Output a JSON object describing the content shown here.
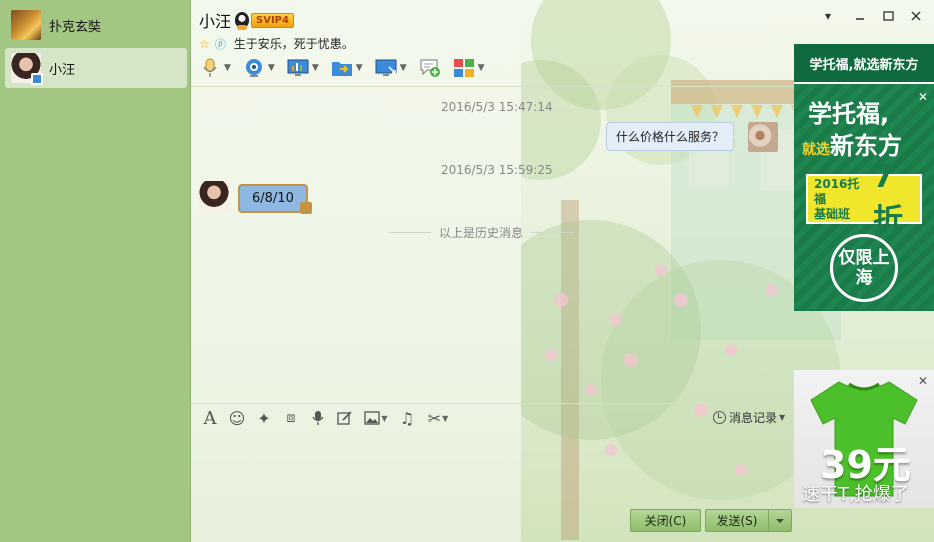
{
  "sidebar": {
    "contacts": [
      {
        "name": "扑克玄奘",
        "avatar": "group-avatar-icon"
      },
      {
        "name": "小汪",
        "avatar": "user-avatar-icon",
        "selected": true
      }
    ]
  },
  "header": {
    "title": "小汪",
    "vip_badge": "SVIP4",
    "signature": "生于安乐，死于忧患。"
  },
  "toolbar": {
    "items": [
      "microphone-icon",
      "video-camera-icon",
      "screen-share-icon",
      "file-transfer-icon",
      "remote-desktop-icon",
      "add-chat-icon",
      "apps-icon"
    ]
  },
  "chat": {
    "messages": [
      {
        "timestamp": "2016/5/3 15:47:14",
        "direction": "outgoing",
        "text": "什么价格什么服务？"
      },
      {
        "timestamp": "2016/5/3 15:59:25",
        "direction": "incoming",
        "text": "6/8/10"
      }
    ],
    "history_divider": "以上是历史消息"
  },
  "input_toolbar": {
    "items": [
      "font-icon",
      "emoji-icon",
      "magic-icon",
      "screenshot-icon",
      "voice-icon",
      "edit-icon",
      "image-icon",
      "music-icon",
      "scissors-icon"
    ],
    "history_label": "消息记录"
  },
  "buttons": {
    "close": "关闭(C)",
    "send": "发送(S)"
  },
  "ads": {
    "ad1": {
      "top": "学托福,就选新东方",
      "headline1": "学托福,",
      "headline2_small": "就选",
      "headline2": "新东方",
      "panel_small_1": "2016托福",
      "panel_small_2": "基础班",
      "discount": "7折",
      "stamp": "仅限上海"
    },
    "ad2": {
      "price": "39元",
      "subtitle": "速干T,抢爆了"
    }
  },
  "colors": {
    "sidebar": "#a3c683",
    "accent_green": "#8fbd6c",
    "bubble_outgoing": "#e3eef9",
    "bubble_incoming": "#8eb8e2"
  }
}
